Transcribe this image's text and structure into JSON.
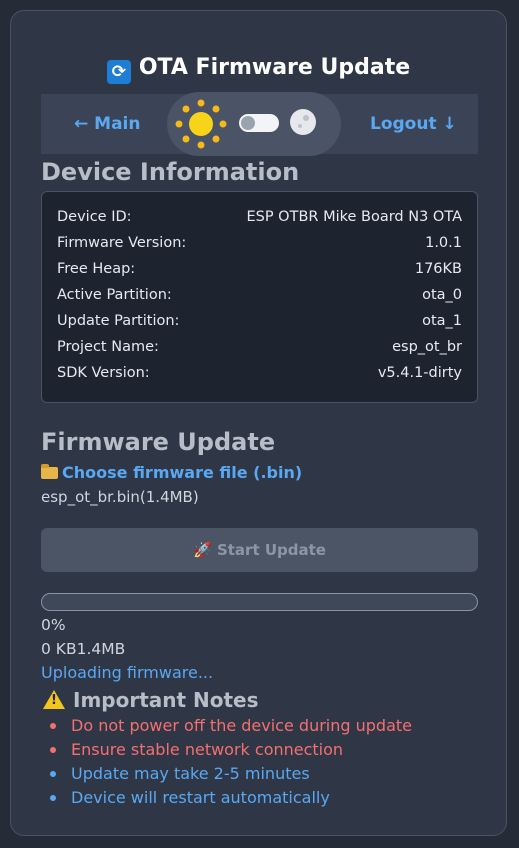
{
  "header": {
    "title": "OTA Firmware Update",
    "title_icon": "refresh-icon"
  },
  "nav": {
    "main_label": "← Main",
    "logout_label": "Logout ↓"
  },
  "device_info": {
    "heading": "Device Information",
    "rows": [
      {
        "label": "Device ID:",
        "value": "ESP OTBR Mike Board N3 OTA"
      },
      {
        "label": "Firmware Version:",
        "value": "1.0.1"
      },
      {
        "label": "Free Heap:",
        "value": "176KB"
      },
      {
        "label": "Active Partition:",
        "value": "ota_0"
      },
      {
        "label": "Update Partition:",
        "value": "ota_1"
      },
      {
        "label": "Project Name:",
        "value": "esp_ot_br"
      },
      {
        "label": "SDK Version:",
        "value": "v5.4.1-dirty"
      }
    ]
  },
  "firmware": {
    "heading": "Firmware Update",
    "choose_label": "Choose firmware file (.bin)",
    "file_name": "esp_ot_br.bin(1.4MB)",
    "start_label": "Start Update",
    "progress_percent_text": "0%",
    "progress_fraction": 0,
    "size_text": "0 KB1.4MB",
    "status": "Uploading firmware..."
  },
  "notes": {
    "heading": "Important Notes",
    "items": [
      {
        "text": "Do not power off the device during update",
        "color": "#f46f6f"
      },
      {
        "text": "Ensure stable network connection",
        "color": "#f46f6f"
      },
      {
        "text": "Update may take 2-5 minutes",
        "color": "#5aa7f2"
      },
      {
        "text": "Device will restart automatically",
        "color": "#5aa7f2"
      }
    ]
  },
  "colors": {
    "accent": "#5aa7f2",
    "warning": "#f46f6f",
    "card": "#2f3746"
  }
}
